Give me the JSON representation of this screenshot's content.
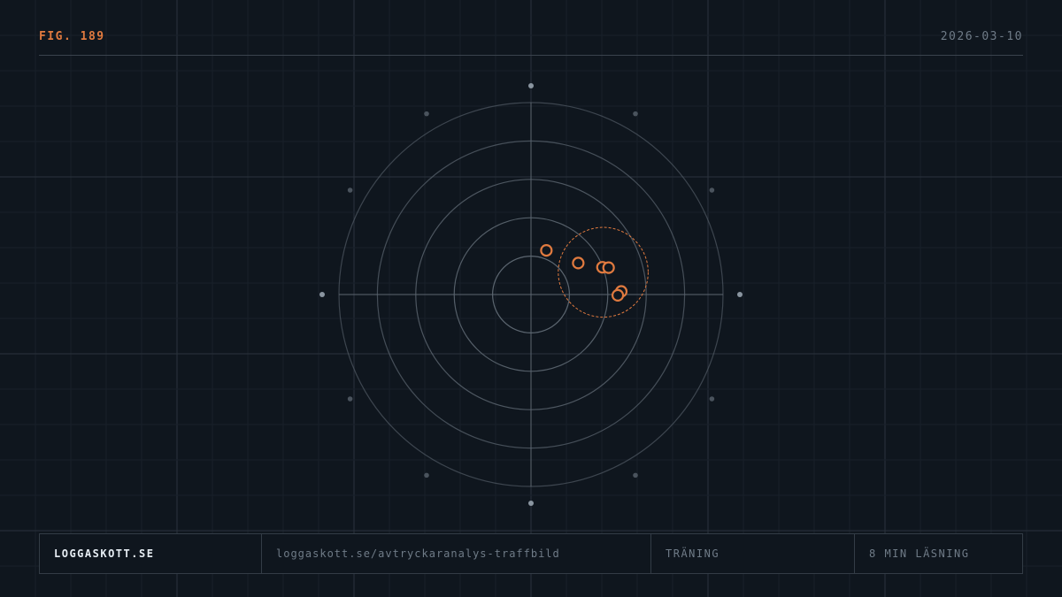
{
  "header": {
    "figure_label": "FIG. 189",
    "date": "2026-03-10"
  },
  "colors": {
    "background": "#0f161e",
    "accent": "#e07a3f",
    "ring": "#5c6670",
    "muted_text": "#6f7b87",
    "bright_text": "#e6edf3"
  },
  "diagram": {
    "rings": 5,
    "compass_dots": 12,
    "shots": [
      {
        "x": 0.4,
        "y": 1.15
      },
      {
        "x": 1.23,
        "y": 0.82
      },
      {
        "x": 1.86,
        "y": 0.71
      },
      {
        "x": 2.02,
        "y": 0.7
      },
      {
        "x": 2.35,
        "y": 0.08
      },
      {
        "x": 2.26,
        "y": -0.02
      }
    ],
    "group_center": {
      "x": 1.88,
      "y": 0.58
    },
    "group_radius": 1.17
  },
  "footer": {
    "site": "LOGGASKOTT.SE",
    "url": "loggaskott.se/avtryckaranalys-traffbild",
    "category": "TRÄNING",
    "reading_time": "8 MIN LÄSNING"
  }
}
